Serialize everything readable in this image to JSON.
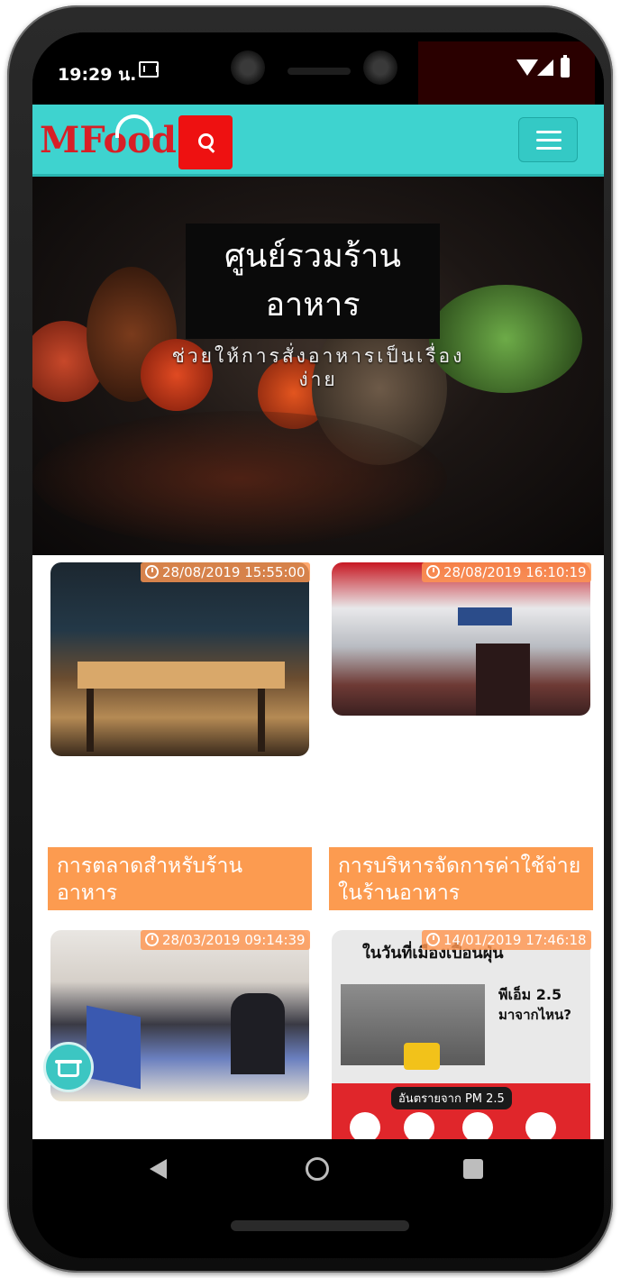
{
  "status_bar": {
    "time": "19:29 น."
  },
  "header": {
    "logo_text": "MFood"
  },
  "hero": {
    "title": "ศูนย์รวมร้านอาหาร",
    "subtitle": "ช่วยให้การสั่งอาหารเป็นเรื่องง่าย"
  },
  "cards": [
    {
      "date": "28/08/2019 15:55:00",
      "title": "การตลาดสำหรับร้านอาหาร"
    },
    {
      "date": "28/08/2019 16:10:19",
      "title": "การบริหารจัดการค่าใช้จ่ายในร้านอาหาร"
    },
    {
      "date": "28/03/2019 09:14:39"
    },
    {
      "date": "14/01/2019 17:46:18",
      "poster": {
        "headline": "ในวันที่เมืองเปื้อนฝุ่น",
        "pm_title": "พีเอ็ม 2.5",
        "pm_question": "มาจากไหน?",
        "danger": "อันตรายจาก PM 2.5"
      }
    }
  ],
  "icons": {
    "search": "search-icon",
    "menu": "hamburger-menu-icon",
    "clock": "clock-icon",
    "basket": "basket-icon",
    "back": "back-icon",
    "home": "home-icon",
    "recent": "recent-apps-icon"
  },
  "colors": {
    "navbar": "#3ed3cf",
    "search_button": "#ee1111",
    "logo": "#d81f26",
    "caption": "#fc9b50",
    "basket": "#3cc6c2"
  }
}
